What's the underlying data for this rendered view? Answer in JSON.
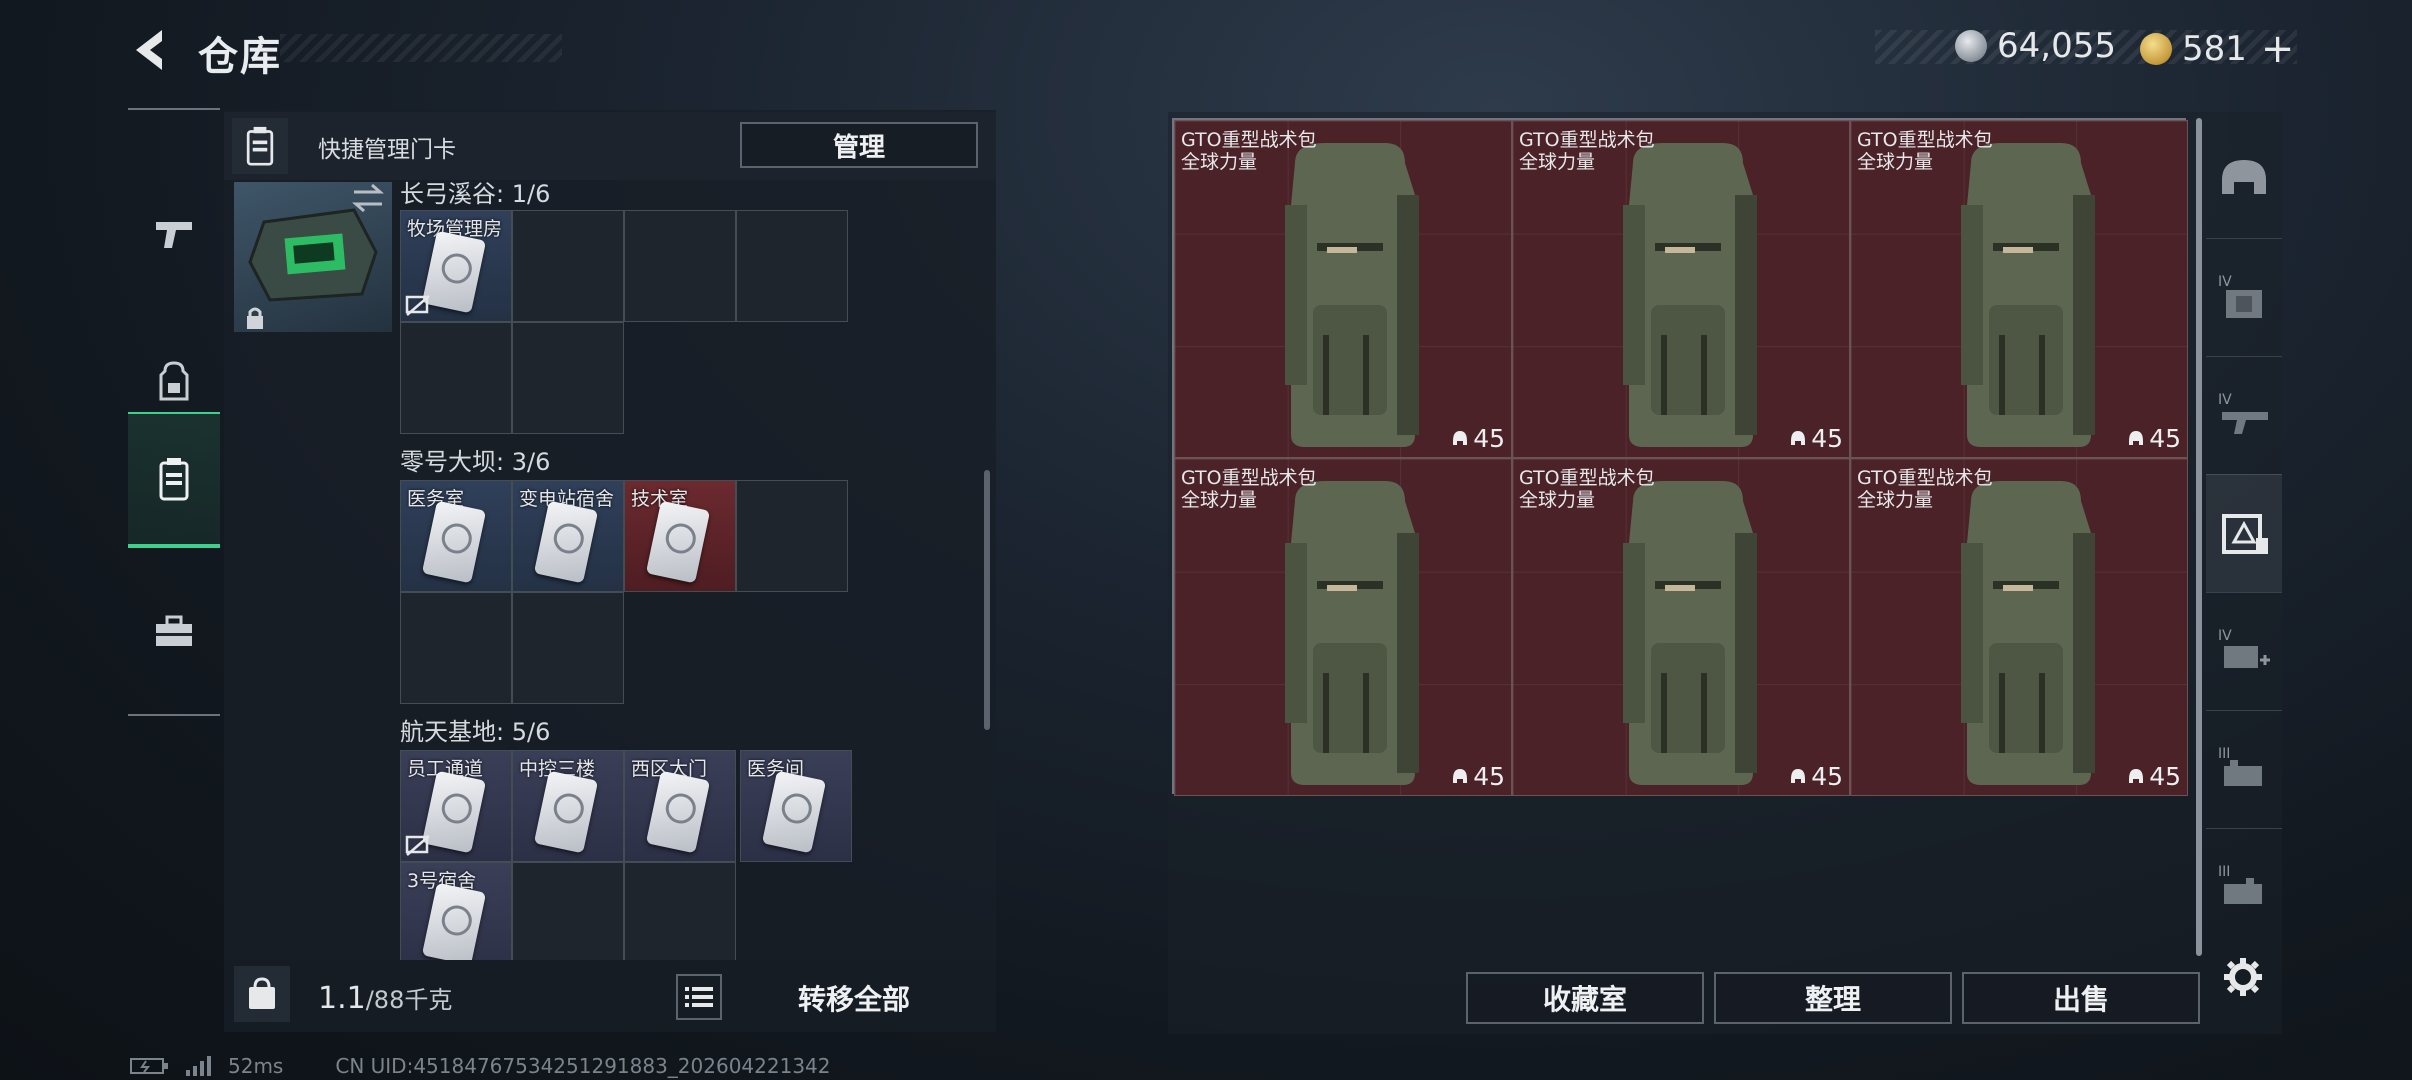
{
  "header": {
    "title": "仓库",
    "currency_1": "64,055",
    "currency_2": "581",
    "currency_2_plus": "+"
  },
  "left_nav": [
    "gun-icon",
    "backpack-icon",
    "keycard-case-icon",
    "toolbox-icon"
  ],
  "quick_manage": {
    "label": "快捷管理门卡",
    "manage_button": "管理"
  },
  "sections": [
    {
      "title": "长弓溪谷: 1/6",
      "slots": [
        {
          "name": "牧场管理房",
          "style": "filled",
          "no_icon": true
        }
      ]
    },
    {
      "title": "零号大坝: 3/6",
      "slots": [
        {
          "name": "医务室",
          "style": "filled"
        },
        {
          "name": "变电站宿舍",
          "style": "filled"
        },
        {
          "name": "技术室",
          "style": "red"
        }
      ]
    },
    {
      "title": "航天基地: 5/6",
      "slots": [
        {
          "name": "员工通道",
          "style": "lavender",
          "no_icon": true
        },
        {
          "name": "中控三楼",
          "style": "lavender"
        },
        {
          "name": "西区大门",
          "style": "lavender"
        },
        {
          "name": "医务间",
          "style": "lavender"
        },
        {
          "name": "3号宿舍",
          "style": "lavender"
        }
      ]
    }
  ],
  "bottom": {
    "weight": "1.1",
    "weight_cap": "/88千克",
    "transfer_all": "转移全部"
  },
  "status": {
    "ping": "52ms",
    "uid": "CN UID:451847675342512918​83_202604221342"
  },
  "items": [
    {
      "name": "GTO重型战术包",
      "sub": "全球力量",
      "qty": "45"
    },
    {
      "name": "GTO重型战术包",
      "sub": "全球力量",
      "qty": "45"
    },
    {
      "name": "GTO重型战术包",
      "sub": "全球力量",
      "qty": "45"
    },
    {
      "name": "GTO重型战术包",
      "sub": "全球力量",
      "qty": "45"
    },
    {
      "name": "GTO重型战术包",
      "sub": "全球力量",
      "qty": "45"
    },
    {
      "name": "GTO重型战术包",
      "sub": "全球力量",
      "qty": "45"
    }
  ],
  "side_tabs": [
    "helmet-icon",
    "armor-iv-icon",
    "weapon-iv-icon",
    "keycard-tab-icon",
    "medical-iv-icon",
    "ammo-iii-icon",
    "ammo-iii-alt-icon"
  ],
  "actions": {
    "collection": "收藏室",
    "sort": "整理",
    "sell": "出售"
  },
  "colors": {
    "accent_green": "#3fd08b",
    "item_red": "#4a2228"
  }
}
